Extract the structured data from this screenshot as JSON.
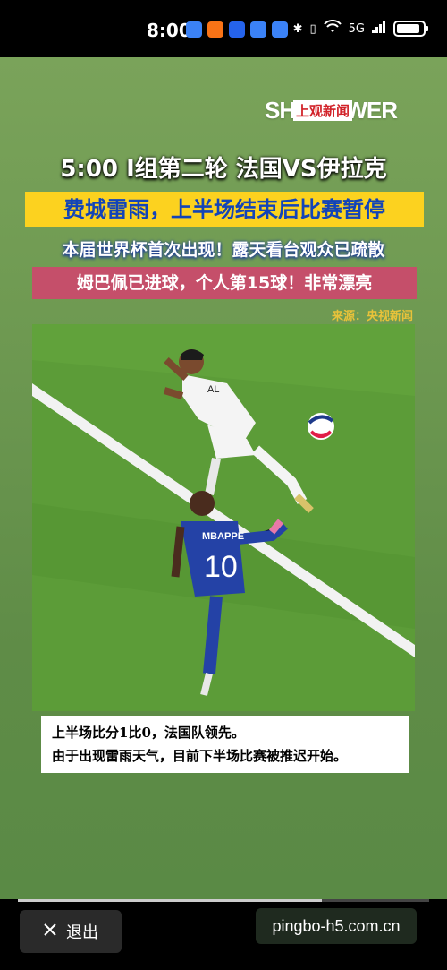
{
  "status_bar": {
    "time": "8:00",
    "network": "5G",
    "battery_level": 0.9
  },
  "poster": {
    "logo_text": "SHODOWER",
    "logo_overlay": "上观新闻",
    "headline": "5:00 I组第二轮 法国VS伊拉克",
    "banner_yellow": "费城雷雨，上半场结束后比赛暂停",
    "subheadline": "本届世界杯首次出现！露天看台观众已疏散",
    "banner_pink": "姆巴佩已进球，个人第15球！非常漂亮",
    "source": "来源：央视新闻",
    "caption_line1": "上半场比分1比0，法国队领先。",
    "caption_line2": "由于出现雷雨天气，目前下半场比赛被推迟开始。",
    "jersey_back_name": "MBAPPE",
    "jersey_number": "10",
    "opponent_name": "AL"
  },
  "bottom_bar": {
    "exit_label": "退出",
    "watermark": "pingbo-h5.com.cn",
    "progress": 0.74
  },
  "colors": {
    "banner_yellow": "#fcd21f",
    "banner_yellow_text": "#1244b8",
    "banner_pink": "#c54f6a",
    "source": "#e8c23a",
    "pitch": "#5a9a36"
  }
}
